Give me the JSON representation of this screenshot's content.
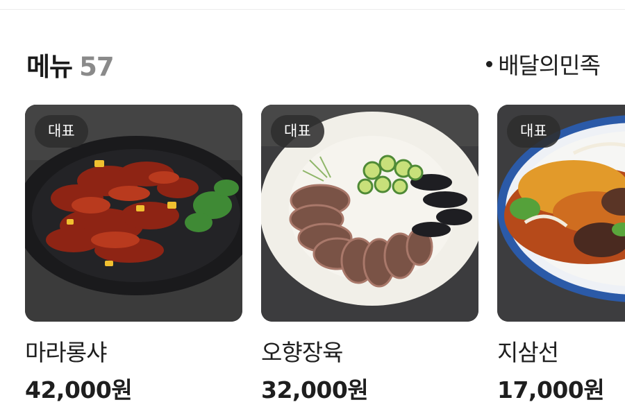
{
  "header": {
    "title": "메뉴",
    "count": "57",
    "source": "배달의민족"
  },
  "menu_items": [
    {
      "badge": "대표",
      "name": "마라롱샤",
      "price": "42,000원",
      "image": "spicy-crayfish-dish"
    },
    {
      "badge": "대표",
      "name": "오향장육",
      "price": "32,000원",
      "image": "sliced-braised-pork-plate"
    },
    {
      "badge": "대표",
      "name": "지삼선",
      "price": "17,000원",
      "image": "stir-fried-vegetable-dish"
    }
  ],
  "colors": {
    "badge_bg": "#2d2d2d",
    "count_gray": "#8a8a8a",
    "text": "#1e1e1e"
  }
}
